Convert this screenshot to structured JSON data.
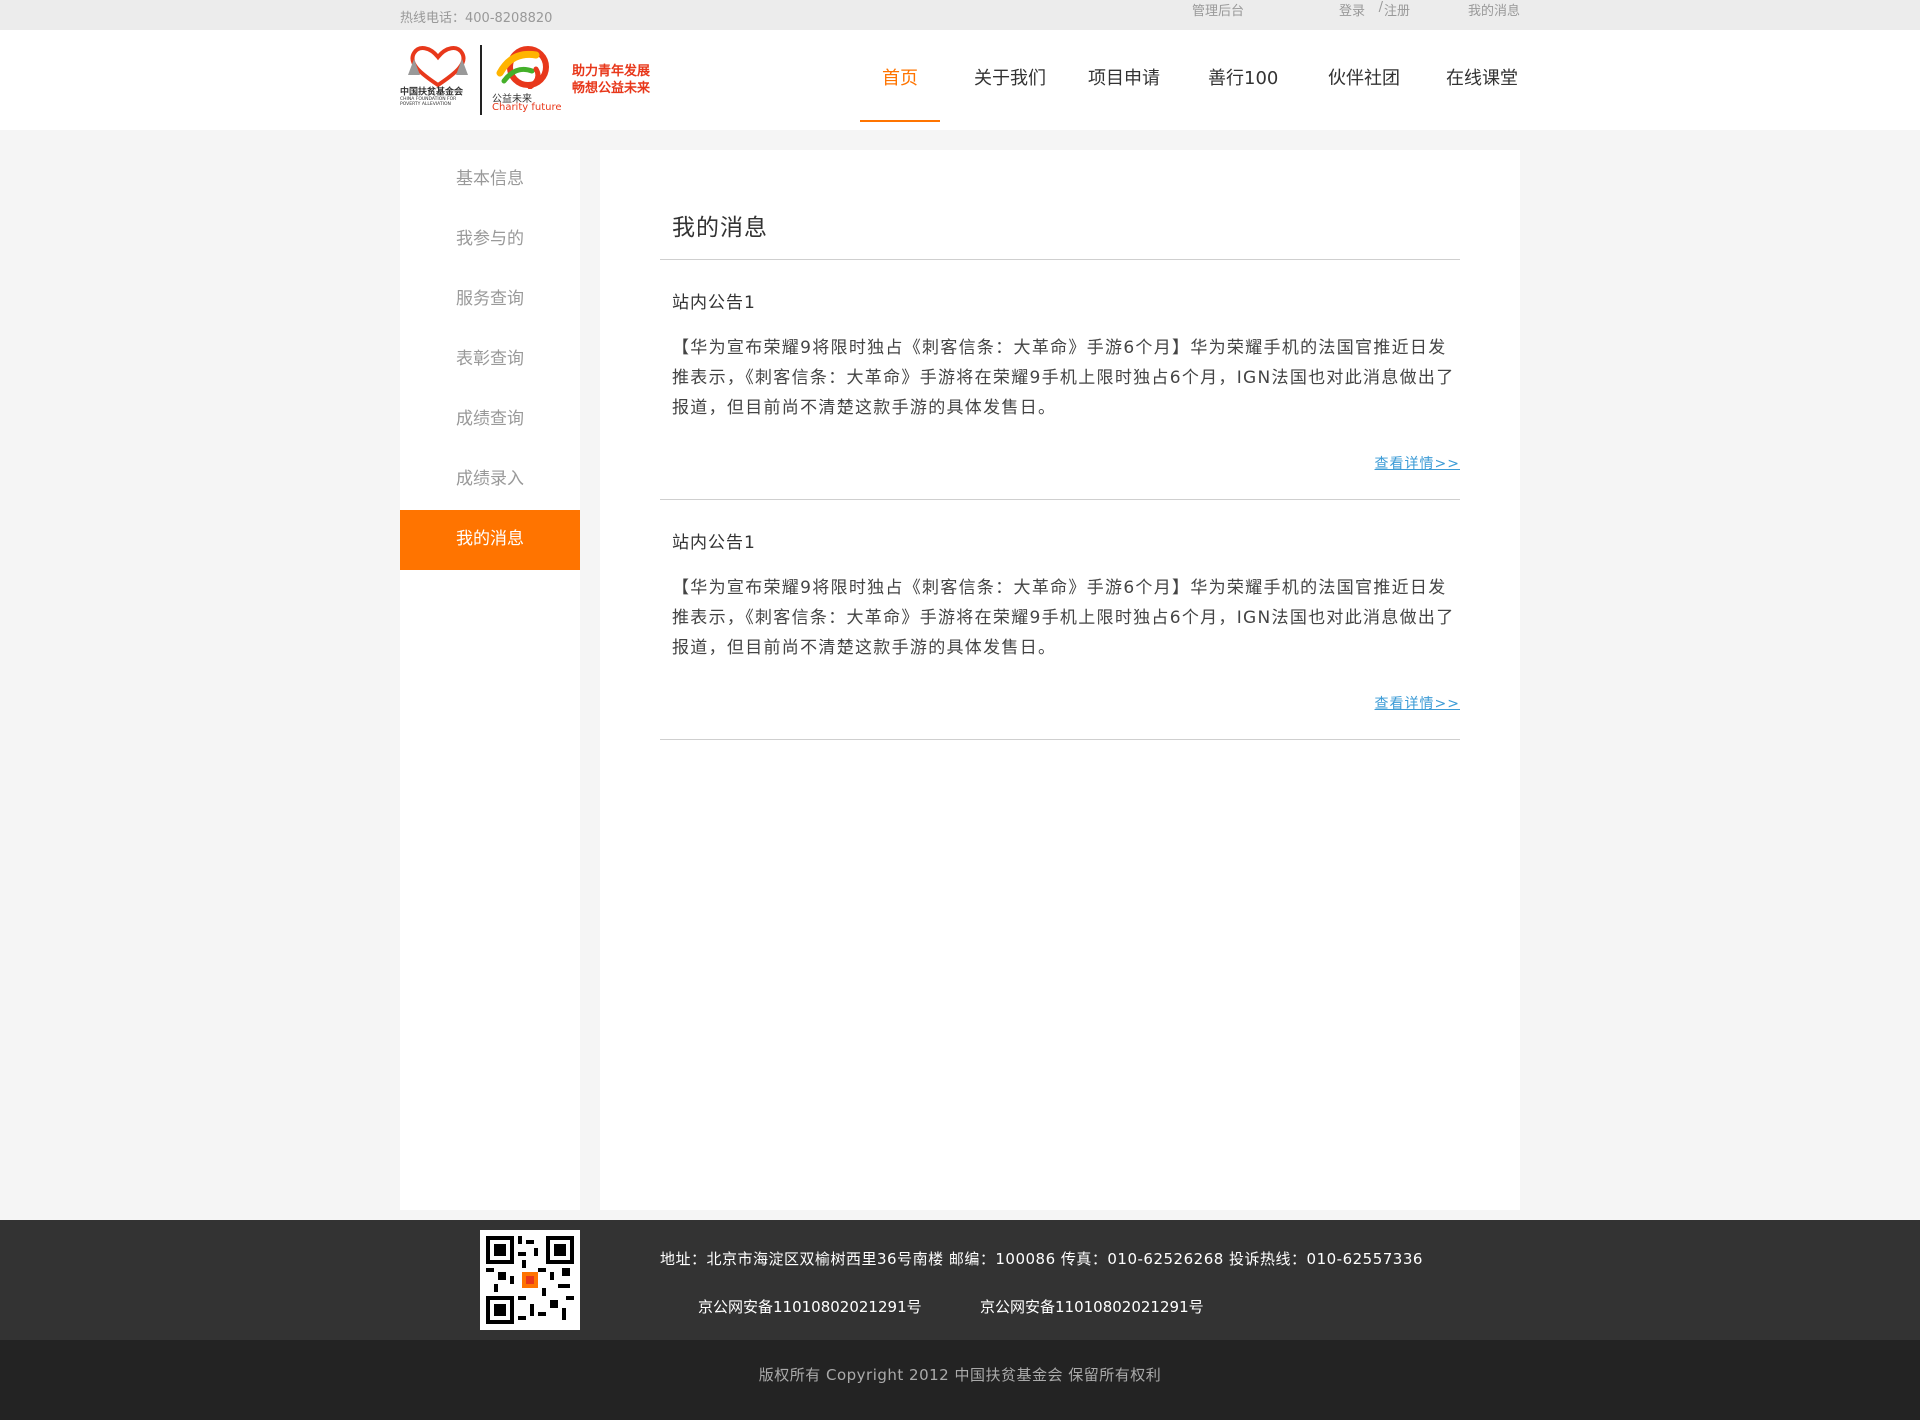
{
  "topbar": {
    "hotline": "热线电话：400-8208820",
    "admin": "管理后台",
    "login": "登录",
    "separator": "/",
    "register": "注册",
    "my_messages": "我的消息"
  },
  "logo": {
    "cfpa_text": "中国扶贫基金会",
    "cfpa_en": "CHINA FOUNDATION FOR POVERTY ALLEVIATION",
    "charity_cn": "公益未来",
    "charity_en": "Charity future",
    "slogan_line1": "助力青年发展",
    "slogan_line2": "畅想公益未来"
  },
  "nav": {
    "items": [
      {
        "label": "首页"
      },
      {
        "label": "关于我们"
      },
      {
        "label": "项目申请"
      },
      {
        "label": "善行100"
      },
      {
        "label": "伙伴社团"
      },
      {
        "label": "在线课堂"
      }
    ]
  },
  "sidebar": {
    "items": [
      {
        "label": "基本信息"
      },
      {
        "label": "我参与的"
      },
      {
        "label": "服务查询"
      },
      {
        "label": "表彰查询"
      },
      {
        "label": "成绩查询"
      },
      {
        "label": "成绩录入"
      },
      {
        "label": "我的消息"
      }
    ]
  },
  "content": {
    "title": "我的消息",
    "messages": [
      {
        "title": "站内公告1",
        "body": "【华为宣布荣耀9将限时独占《刺客信条：大革命》手游6个月】华为荣耀手机的法国官推近日发推表示，《刺客信条：大革命》手游将在荣耀9手机上限时独占6个月，IGN法国也对此消息做出了报道，但目前尚不清楚这款手游的具体发售日。",
        "link": "查看详情>>"
      },
      {
        "title": "站内公告1",
        "body": "【华为宣布荣耀9将限时独占《刺客信条：大革命》手游6个月】华为荣耀手机的法国官推近日发推表示，《刺客信条：大革命》手游将在荣耀9手机上限时独占6个月，IGN法国也对此消息做出了报道，但目前尚不清楚这款手游的具体发售日。",
        "link": "查看详情>>"
      }
    ]
  },
  "footer": {
    "address": "地址：北京市海淀区双榆树西里36号南楼 邮编：100086 传真：010-62526268 投诉热线：010-62557336",
    "icp1": "京公网安备11010802021291号",
    "icp2": "京公网安备11010802021291号",
    "copyright": "版权所有 Copyright 2012 中国扶贫基金会 保留所有权利"
  },
  "colors": {
    "accent": "#ff7400",
    "link": "#3b9bd6",
    "footer_top": "#333333",
    "footer_bottom": "#232323"
  }
}
